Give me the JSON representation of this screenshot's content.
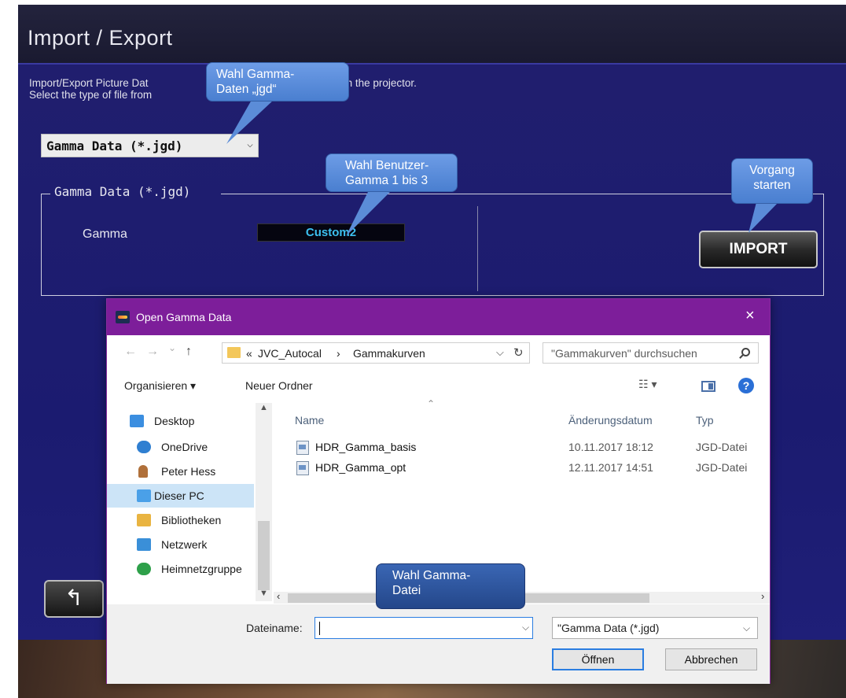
{
  "app": {
    "title": "Import / Export",
    "description_line1": "Import/Export Picture Dat",
    "description_line1_tail": "a Data to/from the projector.",
    "description_line2": "Select the type of file from",
    "file_type_select": "Gamma Data (*.jgd)",
    "group_title": "Gamma Data (*.jgd)",
    "gamma_label": "Gamma",
    "gamma_value": "Custom2",
    "import_button": "IMPORT",
    "back_button": "↰"
  },
  "callouts": {
    "select_type": [
      "Wahl Gamma-",
      "Daten „jgd“"
    ],
    "select_gamma": [
      "Wahl Benutzer-",
      "Gamma 1 bis 3"
    ],
    "start_process": [
      "Vorgang",
      "starten"
    ],
    "select_file": [
      "Wahl Gamma-",
      "Datei"
    ]
  },
  "dialog": {
    "title": "Open Gamma Data",
    "close": "×",
    "nav": {
      "back": "←",
      "forward": "→",
      "recent": "⌄",
      "up": "↑"
    },
    "address": {
      "prefix": "«",
      "parts": [
        "JVC_Autocal",
        "›",
        "Gammakurven"
      ]
    },
    "search_placeholder": "\"Gammakurven\" durchsuchen",
    "toolbar": {
      "organize": "Organisieren ▾",
      "new_folder": "Neuer Ordner",
      "view": "☷ ▾",
      "help": "?"
    },
    "nav_pane": [
      {
        "label": "Desktop",
        "icon": "desktop-icon",
        "color": "#3b8ee0"
      },
      {
        "label": "OneDrive",
        "icon": "onedrive-icon",
        "color": "#2f7fd1"
      },
      {
        "label": "Peter Hess",
        "icon": "user-icon",
        "color": "#b0703a"
      },
      {
        "label": "Dieser PC",
        "icon": "computer-icon",
        "color": "#4aa0e8",
        "selected": true
      },
      {
        "label": "Bibliotheken",
        "icon": "library-icon",
        "color": "#e9b441"
      },
      {
        "label": "Netzwerk",
        "icon": "network-icon",
        "color": "#3a8fd8"
      },
      {
        "label": "Heimnetzgruppe",
        "icon": "homegroup-icon",
        "color": "#2ea04a"
      }
    ],
    "columns": {
      "name": "Name",
      "date": "Änderungsdatum",
      "type": "Typ"
    },
    "files": [
      {
        "name": "HDR_Gamma_basis",
        "date": "10.11.2017 18:12",
        "type": "JGD-Datei"
      },
      {
        "name": "HDR_Gamma_opt",
        "date": "12.11.2017 14:51",
        "type": "JGD-Datei"
      }
    ],
    "filename_label": "Dateiname:",
    "filename_value": "",
    "filter": "\"Gamma Data (*.jgd)",
    "open_button": "Öffnen",
    "cancel_button": "Abbrechen"
  }
}
